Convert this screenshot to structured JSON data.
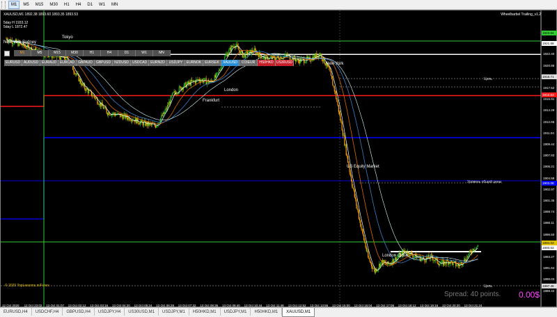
{
  "toolbar": {
    "timeframes": [
      "M1",
      "M5",
      "M15",
      "M30",
      "H1",
      "H4",
      "D1",
      "W1",
      "MN"
    ],
    "active": "M1"
  },
  "chart": {
    "title": "XAUUSD,M1  1892.38 1893.60 1893.35 1893.53",
    "ma1": "5day H 1933.12",
    "ma2": "5day L 1872.47",
    "indicator_name": "Wheelbarbel Trailing_v1.2",
    "copyright": "© 2020 TopLessons.in/Forex",
    "spread": "Spread: 40 points.",
    "profit": "0.00$",
    "colors": {
      "background": "#000000",
      "candle_up": "#22c22a",
      "candle_down": "#ffa600",
      "ma_fast": "#ffffff",
      "ma_mid": "#dd6b00",
      "ma_slow": "#3a7fc8",
      "ma_long": "#d8ffff"
    }
  },
  "panel": {
    "timeframes": [
      "M1",
      "M5",
      "M15",
      "M30",
      "H1",
      "H4",
      "D1",
      "W1",
      "MN"
    ],
    "active_tf": "M1",
    "symbols": [
      "EURUSD",
      "AUDUSD",
      "EURAUD",
      "EURCAD",
      "GBPAUD",
      "GBPUSD",
      "NZDUSD",
      "USDCAD",
      "EURNZD",
      "USDJPY",
      "EURNOK",
      "EURSEK",
      "XAUUSD",
      "COIEUR",
      "HS0HKD",
      "US30USD"
    ],
    "active_symbol": "XAUUSD",
    "red_symbols": [
      "HS0HKD",
      "US30USD"
    ]
  },
  "sessions": {
    "new_york_sydney": "New York Sydney",
    "tokyo": "Tokyo",
    "london1": "London",
    "frankfurt": "Frankfurt",
    "new_york": "New York",
    "us_equity": "US Equity Market",
    "london_close": "London Close"
  },
  "right_labels": {
    "tsel1": "Цель",
    "level": "Уровень общей цены",
    "tsel2": "Цель"
  },
  "price_tags": [
    "1923.64",
    "1921.68",
    "1918.71",
    "1915.63",
    "1903.08",
    "1894.03",
    "1893.53",
    "1887.46"
  ],
  "y_axis": [
    "1925.65",
    "1924.02",
    "1922.40",
    "1920.86",
    "1919.19",
    "1917.52",
    "1915.91",
    "1914.29",
    "1912.66",
    "1911.04",
    "1909.44",
    "1907.83",
    "1906.21",
    "1904.58",
    "1902.97",
    "1901.35",
    "1899.74",
    "1898.11",
    "1896.50",
    "1894.88",
    "1893.27",
    "1891.64",
    "1890.03",
    "1888.42"
  ],
  "x_axis": [
    "12 Oct 2020",
    "12 Oct 23:02",
    "13 Oct 01:07",
    "13 Oct 02:12",
    "13 Oct 03:16",
    "13 Oct 04:20",
    "13 Oct 05:24",
    "13 Oct 06:28",
    "13 Oct 07:32",
    "13 Oct 08:36",
    "13 Oct 09:40",
    "13 Oct 10:44",
    "13 Oct 11:48",
    "13 Oct 12:52",
    "13 Oct 13:56",
    "13 Oct 15:00",
    "13 Oct 16:04",
    "13 Oct 17:08",
    "13 Oct 18:12",
    "13 Oct 19:16",
    "13 Oct 20:20",
    "13 Oct 21:24"
  ],
  "tabs": [
    "EURUSD,H4",
    "USDCHF,H4",
    "GBPUSD,H4",
    "USDJPY,H4",
    "US30USD,M1",
    "USDJPY,M1",
    "H50HKD,M1",
    "USDJPY,M1",
    "H50HKD,M1",
    "XAUUSD,M1"
  ],
  "active_tab": "XAUUSD,M1",
  "chart_data": {
    "type": "candlestick",
    "price_path": [
      [
        0,
        1924.0
      ],
      [
        1.5,
        1922.0
      ],
      [
        2.8,
        1921.0
      ],
      [
        3.5,
        1917.0
      ],
      [
        4.0,
        1915.5
      ],
      [
        4.6,
        1913.2
      ],
      [
        5.2,
        1912.7
      ],
      [
        5.7,
        1912.3
      ],
      [
        6.2,
        1911.6
      ],
      [
        6.8,
        1911.2
      ],
      [
        7.2,
        1913.0
      ],
      [
        7.6,
        1915.8
      ],
      [
        8.0,
        1916.9
      ],
      [
        8.4,
        1917.5
      ],
      [
        8.8,
        1918.0
      ],
      [
        9.3,
        1917.6
      ],
      [
        9.6,
        1918.5
      ],
      [
        10.0,
        1921.5
      ],
      [
        10.4,
        1923.2
      ],
      [
        10.8,
        1921.5
      ],
      [
        11.3,
        1922.2
      ],
      [
        11.8,
        1921.0
      ],
      [
        12.3,
        1921.2
      ],
      [
        12.8,
        1921.5
      ],
      [
        13.3,
        1920.8
      ],
      [
        13.8,
        1920.9
      ],
      [
        14.3,
        1921.8
      ],
      [
        14.7,
        1919.5
      ],
      [
        15.0,
        1916.0
      ],
      [
        15.3,
        1911.0
      ],
      [
        15.6,
        1905.5
      ],
      [
        15.9,
        1900.5
      ],
      [
        16.2,
        1896.0
      ],
      [
        16.5,
        1891.8
      ],
      [
        16.8,
        1889.8
      ],
      [
        17.1,
        1891.2
      ],
      [
        17.4,
        1890.8
      ],
      [
        17.8,
        1891.8
      ],
      [
        18.2,
        1892.8
      ],
      [
        18.6,
        1892.1
      ],
      [
        19.0,
        1891.6
      ],
      [
        19.4,
        1891.9
      ],
      [
        19.8,
        1890.9
      ],
      [
        20.2,
        1891.3
      ],
      [
        20.6,
        1890.6
      ],
      [
        21.0,
        1891.9
      ],
      [
        21.3,
        1893.2
      ],
      [
        21.5,
        1893.5
      ]
    ],
    "levels": [
      {
        "name": "lime-upper",
        "price": 1923.64,
        "color": "#33cc33"
      },
      {
        "name": "white-upper",
        "price": 1921.68,
        "color": "#ffffff"
      },
      {
        "name": "red-level",
        "price": 1915.63,
        "color": "#ff1a1a"
      },
      {
        "name": "blue-level",
        "price": 1909.2,
        "color": "#0000ff"
      },
      {
        "name": "blue-lower",
        "price": 1903.08,
        "color": "#0000dd"
      },
      {
        "name": "lime-lower",
        "price": 1894.03,
        "color": "#33cc33"
      },
      {
        "name": "white-lower",
        "price": 1892.68,
        "color": "#ffffff"
      }
    ],
    "ylim": [
      1887.5,
      1926.3
    ]
  }
}
